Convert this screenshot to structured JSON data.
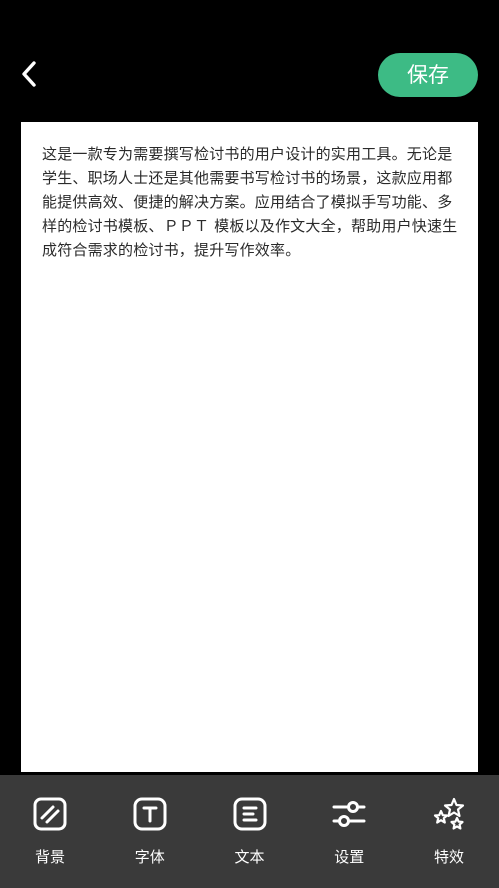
{
  "header": {
    "back_icon": "chevron-left-icon",
    "save_label": "保存",
    "save_color": "#3dbb85"
  },
  "document": {
    "text": "这是一款专为需要撰写检讨书的用户设计的实用工具。无论是学生、职场人士还是其他需要书写检讨书的场景，这款应用都能提供高效、便捷的解决方案。应用结合了模拟手写功能、多样的检讨书模板、ＰＰＴ 模板以及作文大全，帮助用户快速生成符合需求的检讨书，提升写作效率。"
  },
  "toolbar": {
    "items": [
      {
        "label": "背景",
        "icon": "background-icon"
      },
      {
        "label": "字体",
        "icon": "font-icon"
      },
      {
        "label": "文本",
        "icon": "text-icon"
      },
      {
        "label": "设置",
        "icon": "settings-sliders-icon"
      },
      {
        "label": "特效",
        "icon": "sparkles-icon"
      }
    ]
  },
  "colors": {
    "background": "#000000",
    "toolbar": "#3a3a3a",
    "paper": "#ffffff"
  }
}
